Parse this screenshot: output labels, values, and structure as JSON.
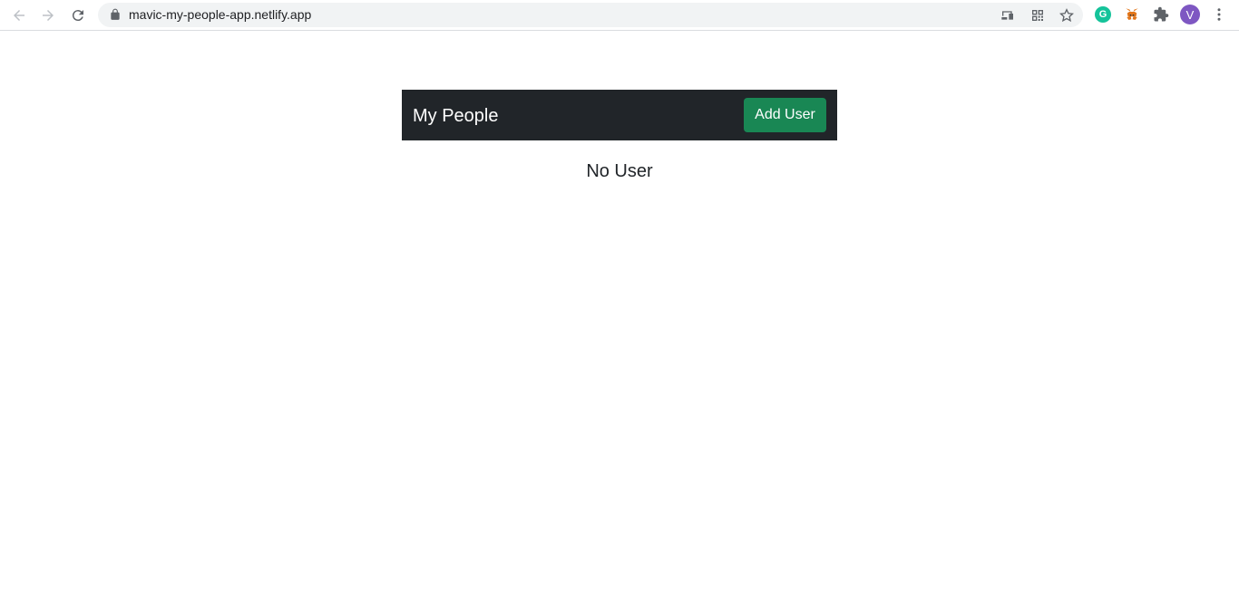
{
  "browser": {
    "url": "mavic-my-people-app.netlify.app",
    "profile_initial": "V",
    "grammarly_letter": "G",
    "accent_colors": {
      "grammarly": "#15c39a",
      "profile": "#7e57c2"
    },
    "icons": [
      "back-icon",
      "forward-icon",
      "reload-icon",
      "lock-icon",
      "cast-icon",
      "qr-code-icon",
      "bookmark-star-icon",
      "grammarly-icon",
      "metamask-icon",
      "extensions-puzzle-icon",
      "profile-avatar",
      "more-menu-icon"
    ]
  },
  "app": {
    "brand": "My People",
    "add_user_label": "Add User",
    "empty_message": "No User",
    "colors": {
      "navbar": "#212529",
      "add_button": "#198754"
    }
  }
}
